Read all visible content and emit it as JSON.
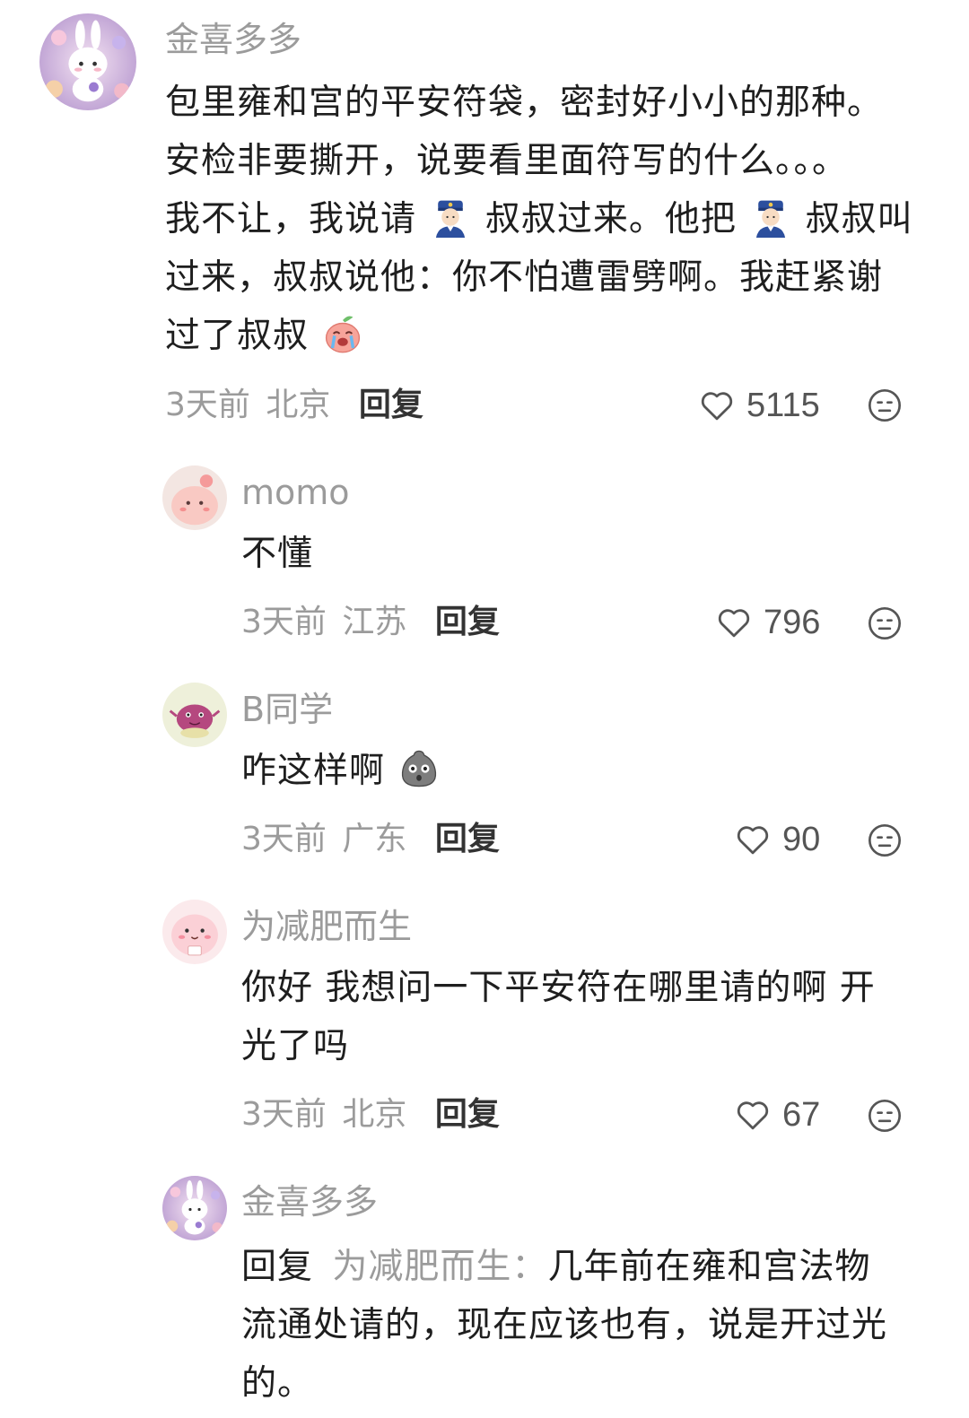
{
  "comments": [
    {
      "author": "金喜多多",
      "lines": [
        "包里雍和宫的平安符袋，密封好小小的那种。",
        "安检非要撕开，说要看里面符写的什么。。。",
        "我不让，我说请",
        "叔叔过来。他把",
        "叔叔叫",
        "过来，叔叔说他：你不怕遭雷劈啊。我赶紧谢",
        "过了叔叔"
      ],
      "time": "3天前",
      "location": "北京",
      "reply_label": "回复",
      "likes": "5115"
    },
    {
      "author": "momo",
      "text": "不懂",
      "time": "3天前",
      "location": "江苏",
      "reply_label": "回复",
      "likes": "796"
    },
    {
      "author": "B同学",
      "text": "咋这样啊",
      "time": "3天前",
      "location": "广东",
      "reply_label": "回复",
      "likes": "90"
    },
    {
      "author": "为减肥而生",
      "lines": [
        "你好 我想问一下平安符在哪里请的啊 开",
        "光了吗"
      ],
      "time": "3天前",
      "location": "北京",
      "reply_label": "回复",
      "likes": "67"
    },
    {
      "author": "金喜多多",
      "reply_prefix": "回复",
      "reply_target": "为减肥而生：",
      "lines": [
        "几年前在雍和宫法物",
        "流通处请的，现在应该也有，说是开过光",
        "的。"
      ]
    }
  ],
  "icons": {
    "like": "heart-outline-icon",
    "dislike": "meh-face-icon",
    "police_emoji": "police-officer-emoji",
    "crying_emoji": "crying-peach-emoji",
    "shocked_emoji": "shocked-stone-emoji"
  },
  "colors": {
    "text": "#1e1e1e",
    "muted": "#9b9b9b"
  }
}
